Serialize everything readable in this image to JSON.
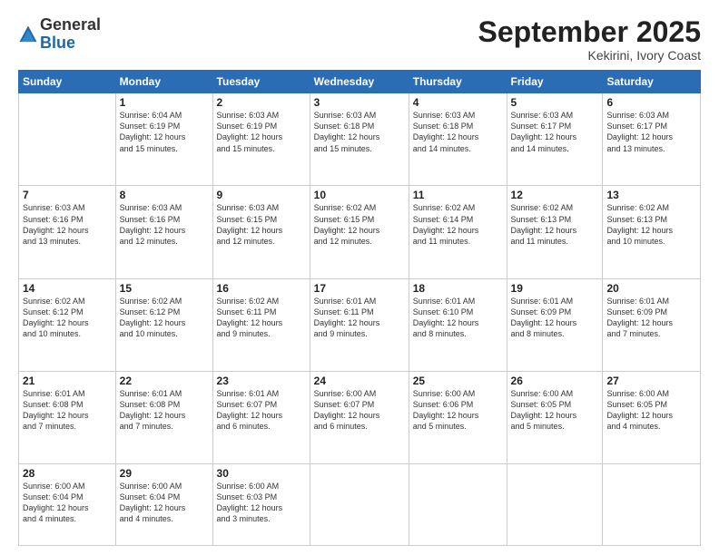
{
  "logo": {
    "general": "General",
    "blue": "Blue"
  },
  "title": "September 2025",
  "subtitle": "Kekirini, Ivory Coast",
  "days_of_week": [
    "Sunday",
    "Monday",
    "Tuesday",
    "Wednesday",
    "Thursday",
    "Friday",
    "Saturday"
  ],
  "weeks": [
    [
      {
        "day": "",
        "info": ""
      },
      {
        "day": "1",
        "info": "Sunrise: 6:04 AM\nSunset: 6:19 PM\nDaylight: 12 hours\nand 15 minutes."
      },
      {
        "day": "2",
        "info": "Sunrise: 6:03 AM\nSunset: 6:19 PM\nDaylight: 12 hours\nand 15 minutes."
      },
      {
        "day": "3",
        "info": "Sunrise: 6:03 AM\nSunset: 6:18 PM\nDaylight: 12 hours\nand 15 minutes."
      },
      {
        "day": "4",
        "info": "Sunrise: 6:03 AM\nSunset: 6:18 PM\nDaylight: 12 hours\nand 14 minutes."
      },
      {
        "day": "5",
        "info": "Sunrise: 6:03 AM\nSunset: 6:17 PM\nDaylight: 12 hours\nand 14 minutes."
      },
      {
        "day": "6",
        "info": "Sunrise: 6:03 AM\nSunset: 6:17 PM\nDaylight: 12 hours\nand 13 minutes."
      }
    ],
    [
      {
        "day": "7",
        "info": "Sunrise: 6:03 AM\nSunset: 6:16 PM\nDaylight: 12 hours\nand 13 minutes."
      },
      {
        "day": "8",
        "info": "Sunrise: 6:03 AM\nSunset: 6:16 PM\nDaylight: 12 hours\nand 12 minutes."
      },
      {
        "day": "9",
        "info": "Sunrise: 6:03 AM\nSunset: 6:15 PM\nDaylight: 12 hours\nand 12 minutes."
      },
      {
        "day": "10",
        "info": "Sunrise: 6:02 AM\nSunset: 6:15 PM\nDaylight: 12 hours\nand 12 minutes."
      },
      {
        "day": "11",
        "info": "Sunrise: 6:02 AM\nSunset: 6:14 PM\nDaylight: 12 hours\nand 11 minutes."
      },
      {
        "day": "12",
        "info": "Sunrise: 6:02 AM\nSunset: 6:13 PM\nDaylight: 12 hours\nand 11 minutes."
      },
      {
        "day": "13",
        "info": "Sunrise: 6:02 AM\nSunset: 6:13 PM\nDaylight: 12 hours\nand 10 minutes."
      }
    ],
    [
      {
        "day": "14",
        "info": "Sunrise: 6:02 AM\nSunset: 6:12 PM\nDaylight: 12 hours\nand 10 minutes."
      },
      {
        "day": "15",
        "info": "Sunrise: 6:02 AM\nSunset: 6:12 PM\nDaylight: 12 hours\nand 10 minutes."
      },
      {
        "day": "16",
        "info": "Sunrise: 6:02 AM\nSunset: 6:11 PM\nDaylight: 12 hours\nand 9 minutes."
      },
      {
        "day": "17",
        "info": "Sunrise: 6:01 AM\nSunset: 6:11 PM\nDaylight: 12 hours\nand 9 minutes."
      },
      {
        "day": "18",
        "info": "Sunrise: 6:01 AM\nSunset: 6:10 PM\nDaylight: 12 hours\nand 8 minutes."
      },
      {
        "day": "19",
        "info": "Sunrise: 6:01 AM\nSunset: 6:09 PM\nDaylight: 12 hours\nand 8 minutes."
      },
      {
        "day": "20",
        "info": "Sunrise: 6:01 AM\nSunset: 6:09 PM\nDaylight: 12 hours\nand 7 minutes."
      }
    ],
    [
      {
        "day": "21",
        "info": "Sunrise: 6:01 AM\nSunset: 6:08 PM\nDaylight: 12 hours\nand 7 minutes."
      },
      {
        "day": "22",
        "info": "Sunrise: 6:01 AM\nSunset: 6:08 PM\nDaylight: 12 hours\nand 7 minutes."
      },
      {
        "day": "23",
        "info": "Sunrise: 6:01 AM\nSunset: 6:07 PM\nDaylight: 12 hours\nand 6 minutes."
      },
      {
        "day": "24",
        "info": "Sunrise: 6:00 AM\nSunset: 6:07 PM\nDaylight: 12 hours\nand 6 minutes."
      },
      {
        "day": "25",
        "info": "Sunrise: 6:00 AM\nSunset: 6:06 PM\nDaylight: 12 hours\nand 5 minutes."
      },
      {
        "day": "26",
        "info": "Sunrise: 6:00 AM\nSunset: 6:05 PM\nDaylight: 12 hours\nand 5 minutes."
      },
      {
        "day": "27",
        "info": "Sunrise: 6:00 AM\nSunset: 6:05 PM\nDaylight: 12 hours\nand 4 minutes."
      }
    ],
    [
      {
        "day": "28",
        "info": "Sunrise: 6:00 AM\nSunset: 6:04 PM\nDaylight: 12 hours\nand 4 minutes."
      },
      {
        "day": "29",
        "info": "Sunrise: 6:00 AM\nSunset: 6:04 PM\nDaylight: 12 hours\nand 4 minutes."
      },
      {
        "day": "30",
        "info": "Sunrise: 6:00 AM\nSunset: 6:03 PM\nDaylight: 12 hours\nand 3 minutes."
      },
      {
        "day": "",
        "info": ""
      },
      {
        "day": "",
        "info": ""
      },
      {
        "day": "",
        "info": ""
      },
      {
        "day": "",
        "info": ""
      }
    ]
  ]
}
